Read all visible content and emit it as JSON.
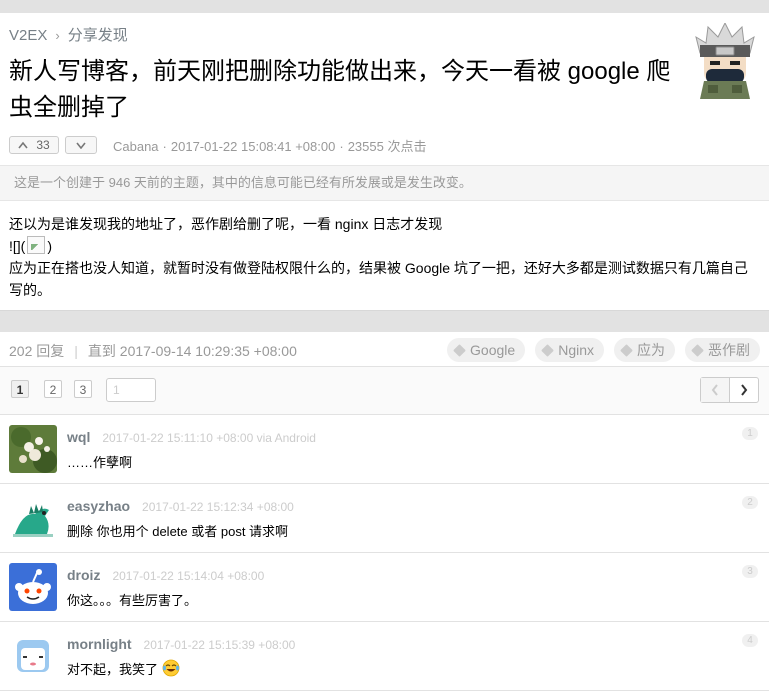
{
  "breadcrumb": {
    "site": "V2EX",
    "separator": "›",
    "node": "分享发现"
  },
  "topic": {
    "title": "新人写博客，前天刚把删除功能做出来，今天一看被 google 爬虫全删掉了",
    "upvotes": "33",
    "author": "Cabana",
    "time": "2017-01-22 15:08:41 +08:00",
    "views": "23555 次点击",
    "notice": "这是一个创建于 946 天前的主题，其中的信息可能已经有所发展或是发生改变。",
    "content": {
      "line1": "还以为是谁发现我的地址了，恶作剧给删了呢，一看 nginx 日志才发现",
      "line2_prefix": "![](",
      "line2_suffix": ")",
      "line3": "应为正在搭也没人知道，就暂时没有做登陆权限什么的，结果被 Google 坑了一把，还好大多都是测试数据只有几篇自己写的。"
    }
  },
  "replies_header": {
    "count": "202 回复",
    "separator": "|",
    "until": "直到 2017-09-14 10:29:35 +08:00",
    "tags": [
      "Google",
      "Nginx",
      "应为",
      "恶作剧"
    ]
  },
  "pager": {
    "pages": [
      "1",
      "2",
      "3"
    ],
    "current": "1",
    "input_placeholder": "1",
    "prev": "‹",
    "next": "›"
  },
  "replies": [
    {
      "user": "wql",
      "time": "2017-01-22 15:11:10 +08:00 via Android",
      "text": "……作孽啊",
      "no": "1"
    },
    {
      "user": "easyzhao",
      "time": "2017-01-22 15:12:34 +08:00",
      "text": "删除 你也用个 delete 或者 post 请求啊",
      "no": "2"
    },
    {
      "user": "droiz",
      "time": "2017-01-22 15:14:04 +08:00",
      "text": "你这。。。有些厉害了。",
      "no": "3"
    },
    {
      "user": "mornlight",
      "time": "2017-01-22 15:15:39 +08:00",
      "text": "对不起，我笑了",
      "no": "4",
      "emoji": "laughing-tears-icon"
    }
  ],
  "colors": {
    "background": "#e2e2e2",
    "link": "#778087",
    "muted": "#999999"
  }
}
